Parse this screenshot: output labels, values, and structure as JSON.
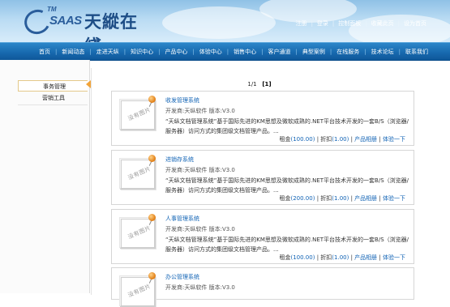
{
  "header": {
    "logo": {
      "tm": "TM",
      "en": "SAAS",
      "cn": "天縱在綫"
    },
    "top_links": [
      "注册",
      "登录",
      "控制面板",
      "收藏此页",
      "设为首页"
    ]
  },
  "nav": {
    "items": [
      "首页",
      "新闻动态",
      "走进天纵",
      "知识中心",
      "产品中心",
      "体验中心",
      "销售中心",
      "客户通道",
      "典型案例",
      "在线服务",
      "技术论坛",
      "联系我们"
    ]
  },
  "sidebar": {
    "items": [
      {
        "label": "事务管理",
        "active": true
      },
      {
        "label": "营销工具",
        "active": false
      }
    ]
  },
  "pager": {
    "current": "1/1",
    "page_link": "[1]"
  },
  "products": [
    {
      "title": "收发管理系统",
      "meta": "开发商:天纵软件  版本:V3.0",
      "desc": "“天纵文档管理系统”基于国际先进的KM思想及微软成熟的.NET平台技术开发的一套B/S（浏览器/服务器）访问方式的集团级文档管理产品。...",
      "rent_label": "租金",
      "rent": "(100.00)",
      "discount_label": "折扣",
      "discount": "(1.00)",
      "album": "产品相册",
      "trial": "体验一下",
      "no_image": "没有图片"
    },
    {
      "title": "进销存系统",
      "meta": "开发商:天纵软件  版本:V3.0",
      "desc": "“天纵文档管理系统”基于国际先进的KM思想及微软成熟的.NET平台技术开发的一套B/S（浏览器/服务器）访问方式的集团级文档管理产品。...",
      "rent_label": "租金",
      "rent": "(200.00)",
      "discount_label": "折扣",
      "discount": "(1.00)",
      "album": "产品相册",
      "trial": "体验一下",
      "no_image": "没有图片"
    },
    {
      "title": "人事管理系统",
      "meta": "开发商:天纵软件  版本:V3.0",
      "desc": "“天纵文档管理系统”基于国际先进的KM思想及微软成熟的.NET平台技术开发的一套B/S（浏览器/服务器）访问方式的集团级文档管理产品。...",
      "rent_label": "租金",
      "rent": "(100.00)",
      "discount_label": "折扣",
      "discount": "(1.00)",
      "album": "产品相册",
      "trial": "体验一下",
      "no_image": "没有图片"
    },
    {
      "title": "办公管理系统",
      "meta": "开发商:天纵软件  版本:V3.0",
      "desc": "",
      "no_image": "没有图片"
    }
  ],
  "colors": {
    "link_blue": "#1163b5",
    "nav_blue": "#1768ad",
    "accent_orange": "#f2a43a"
  }
}
